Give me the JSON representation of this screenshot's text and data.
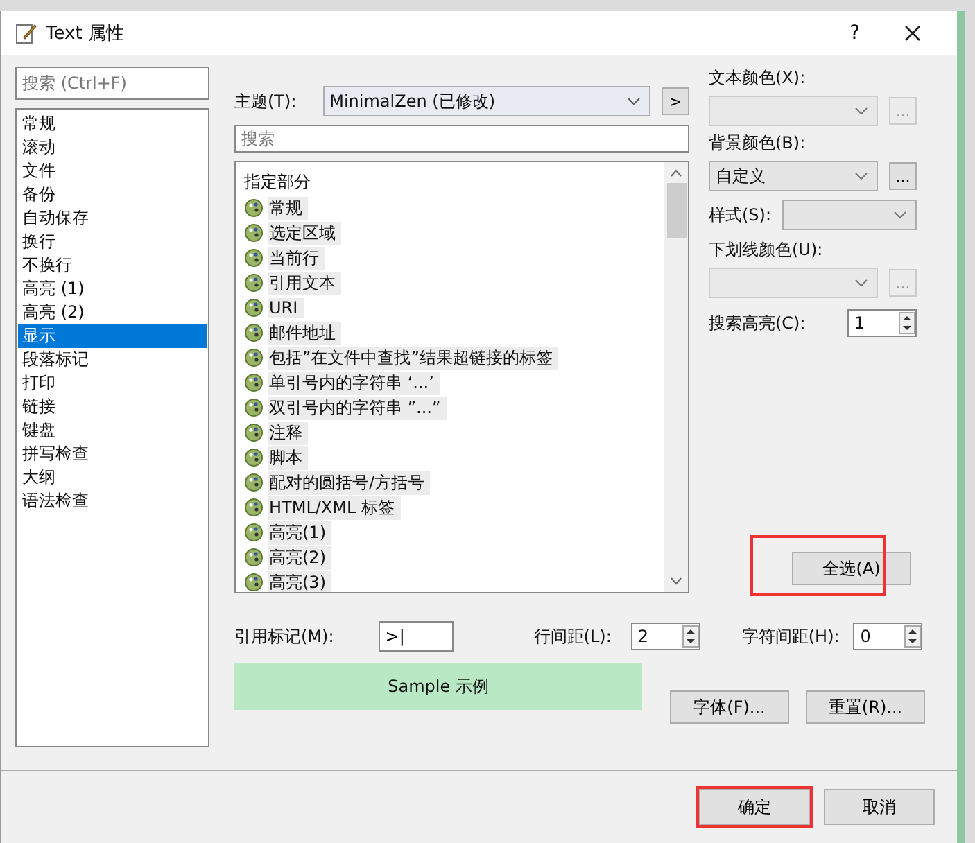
{
  "window": {
    "title": "Text 属性",
    "help": "?"
  },
  "sidebar": {
    "search": {
      "placeholder": "搜索 (Ctrl+F)"
    },
    "items": [
      {
        "label": "常规",
        "selected": false
      },
      {
        "label": "滚动",
        "selected": false
      },
      {
        "label": "文件",
        "selected": false
      },
      {
        "label": "备份",
        "selected": false
      },
      {
        "label": "自动保存",
        "selected": false
      },
      {
        "label": "换行",
        "selected": false
      },
      {
        "label": "不换行",
        "selected": false
      },
      {
        "label": "高亮 (1)",
        "selected": false
      },
      {
        "label": "高亮 (2)",
        "selected": false
      },
      {
        "label": "显示",
        "selected": true
      },
      {
        "label": "段落标记",
        "selected": false
      },
      {
        "label": "打印",
        "selected": false
      },
      {
        "label": "链接",
        "selected": false
      },
      {
        "label": "键盘",
        "selected": false
      },
      {
        "label": "拼写检查",
        "selected": false
      },
      {
        "label": "大纲",
        "selected": false
      },
      {
        "label": "语法检查",
        "selected": false
      }
    ]
  },
  "theme": {
    "label": "主题(T):",
    "value": "MinimalZen (已修改)",
    "next": ">"
  },
  "element_search": {
    "placeholder": "搜索"
  },
  "elements": {
    "header": "指定部分",
    "items": [
      {
        "label": "常规"
      },
      {
        "label": "选定区域"
      },
      {
        "label": "当前行"
      },
      {
        "label": "引用文本"
      },
      {
        "label": "URI"
      },
      {
        "label": "邮件地址"
      },
      {
        "label": "包括”在文件中查找”结果超链接的标签"
      },
      {
        "label": "单引号内的字符串 ‘...’"
      },
      {
        "label": "双引号内的字符串 ”...”"
      },
      {
        "label": "注释"
      },
      {
        "label": "脚本"
      },
      {
        "label": "配对的圆括号/方括号"
      },
      {
        "label": "HTML/XML 标签"
      },
      {
        "label": "高亮(1)"
      },
      {
        "label": "高亮(2)"
      },
      {
        "label": "高亮(3)"
      }
    ]
  },
  "text_color": {
    "label": "文本颜色(X):",
    "more": "...",
    "disabled": true
  },
  "background_color": {
    "label": "背景颜色(B):",
    "value": "自定义",
    "more": "...",
    "disabled": false
  },
  "style": {
    "label": "样式(S):"
  },
  "underline_color": {
    "label": "下划线颜色(U):",
    "more": "...",
    "disabled": true
  },
  "search_highlight": {
    "label": "搜索高亮(C):",
    "value": "1"
  },
  "select_all": {
    "label": "全选(A)",
    "highlighted": true
  },
  "quote_mark": {
    "label": "引用标记(M):",
    "value": ">|"
  },
  "line_spacing": {
    "label": "行间距(L):",
    "value": "2"
  },
  "char_spacing": {
    "label": "字符间距(H):",
    "value": "0"
  },
  "sample": {
    "text": "Sample 示例"
  },
  "font_button": {
    "label": "字体(F)...",
    "highlighted": false
  },
  "reset_button": {
    "label": "重置(R)...",
    "highlighted": false
  },
  "footer": [
    {
      "label": "确定",
      "highlighted": true
    },
    {
      "label": "取消",
      "highlighted": false
    }
  ]
}
